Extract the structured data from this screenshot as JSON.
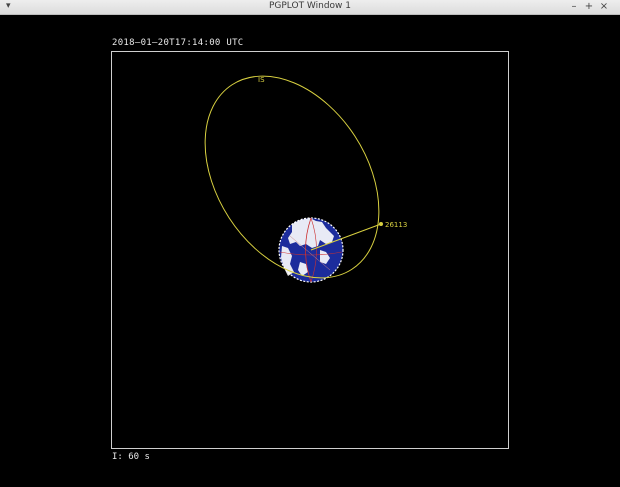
{
  "window": {
    "title": "PGPLOT Window 1",
    "menu_icon": "chevron-down-icon",
    "minimize_label": "–",
    "maximize_label": "+",
    "close_label": "×"
  },
  "plot": {
    "timestamp": "2018–01–20T17:14:00 UTC",
    "speed": "I: 60 s",
    "satellite_id": "26113",
    "apogee_marker": "IS",
    "colors": {
      "orbit": "#d8d040",
      "earth_ocean": "#2030a0",
      "land": "#ffffff",
      "frame": "#cfcfcf",
      "grid": "#cc3030"
    }
  }
}
